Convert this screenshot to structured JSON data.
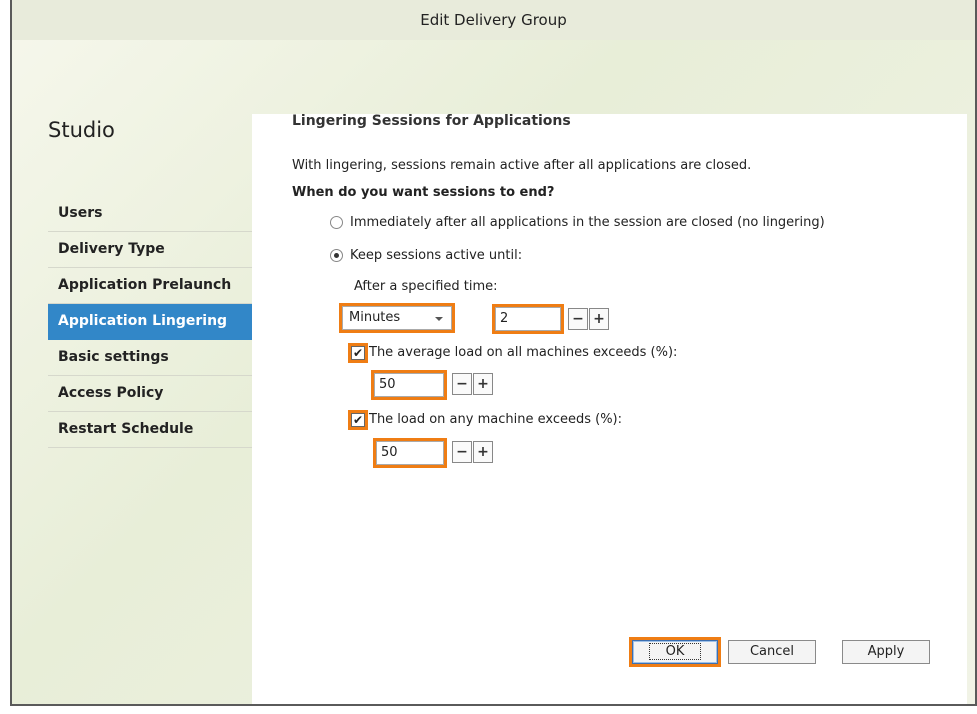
{
  "window": {
    "title": "Edit Delivery Group"
  },
  "sidebar": {
    "brand": "Studio",
    "items": [
      {
        "label": "Users",
        "active": false
      },
      {
        "label": "Delivery Type",
        "active": false
      },
      {
        "label": "Application Prelaunch",
        "active": false
      },
      {
        "label": "Application Lingering",
        "active": true
      },
      {
        "label": "Basic settings",
        "active": false
      },
      {
        "label": "Access Policy",
        "active": false
      },
      {
        "label": "Restart Schedule",
        "active": false
      }
    ]
  },
  "main": {
    "title": "Lingering Sessions for Applications",
    "description": "With lingering, sessions remain active after all applications are closed.",
    "question": "When do you want sessions to end?",
    "options": {
      "immediately": "Immediately after all applications in the session are closed (no lingering)",
      "keep_active": "Keep sessions active until:"
    },
    "selected_option": "keep_active",
    "time": {
      "label": "After a specified time:",
      "unit": "Minutes",
      "value": "2"
    },
    "avg_load": {
      "checked": true,
      "label": "The average load on all machines exceeds (%):",
      "value": "50"
    },
    "any_load": {
      "checked": true,
      "label": "The load on any machine exceeds (%):",
      "value": "50"
    },
    "stepper": {
      "minus": "−",
      "plus": "+"
    }
  },
  "footer": {
    "ok": "OK",
    "cancel": "Cancel",
    "apply": "Apply"
  },
  "colors": {
    "accent": "#3287c8",
    "highlight": "#ef7d14"
  },
  "icons": {
    "dropdown": "chevron-down-icon",
    "checkmark": "checkmark-icon"
  }
}
